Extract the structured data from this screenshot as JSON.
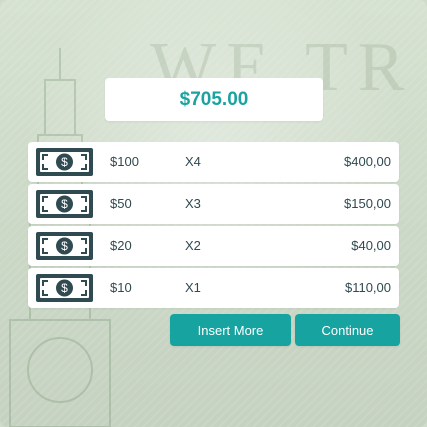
{
  "colors": {
    "accent": "#17a3a0",
    "bill": "#2f4a50",
    "text": "#2f4a50",
    "background": "#cfdccb",
    "card": "#ffffff"
  },
  "watermark": "WE TR",
  "total": "$705.00",
  "rows": [
    {
      "denomination": "$100",
      "quantity": "X4",
      "subtotal": "$400,00",
      "icon": "banknote-icon"
    },
    {
      "denomination": "$50",
      "quantity": "X3",
      "subtotal": "$150,00",
      "icon": "banknote-icon"
    },
    {
      "denomination": "$20",
      "quantity": "X2",
      "subtotal": "$40,00",
      "icon": "banknote-icon"
    },
    {
      "denomination": "$10",
      "quantity": "X1",
      "subtotal": "$110,00",
      "icon": "banknote-icon"
    }
  ],
  "buttons": {
    "insert_more": "Insert More",
    "continue": "Continue"
  }
}
